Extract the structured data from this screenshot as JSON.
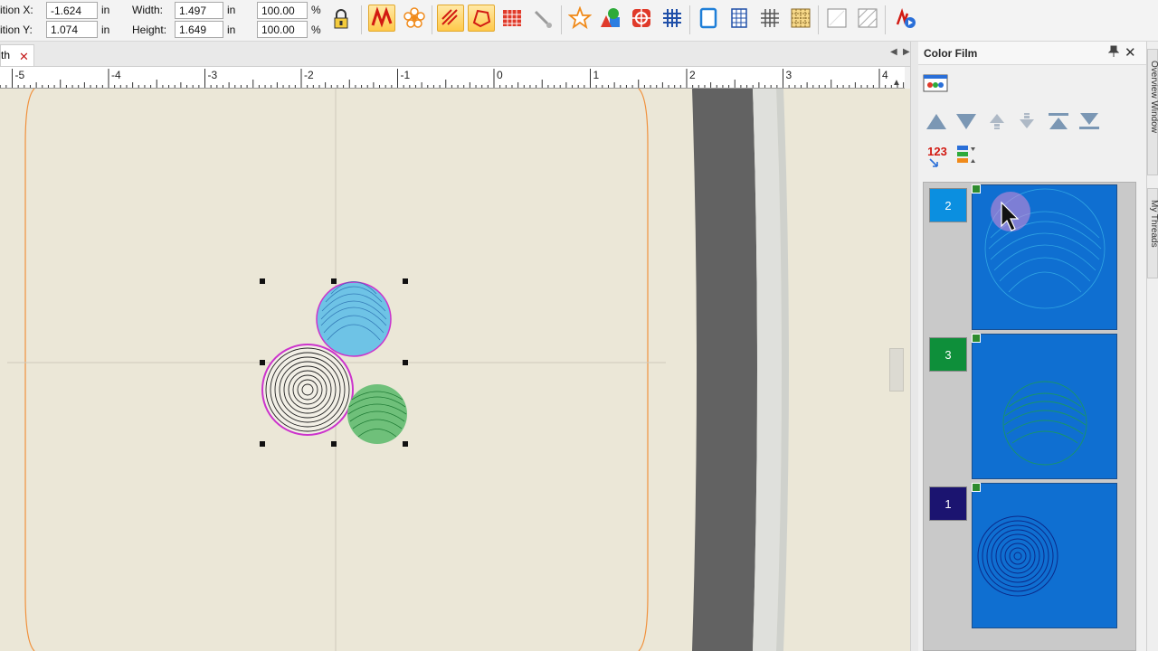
{
  "toolbar": {
    "position_x_label": "ition X:",
    "position_x_value": "-1.624",
    "position_x_unit": "in",
    "position_y_label": "ition Y:",
    "position_y_value": "1.074",
    "position_y_unit": "in",
    "width_label": "Width:",
    "width_value": "1.497",
    "width_unit": "in",
    "height_label": "Height:",
    "height_value": "1.649",
    "height_unit": "in",
    "scale_w_value": "100.00",
    "scale_w_unit": "%",
    "scale_h_value": "100.00",
    "scale_h_unit": "%",
    "tools": [
      "lock-proportions",
      "running-stitch",
      "flower-shape",
      "fill-stitch",
      "shape-outline",
      "grid-fill",
      "connector-tool",
      "star-shape",
      "shapes",
      "quilt-block",
      "crosshatch",
      "frame",
      "grid-small",
      "hash-grid",
      "pattern-fill",
      "blank-texture",
      "diagonal-texture",
      "stitch-player"
    ]
  },
  "document_tab": {
    "label": "th",
    "close": "✕"
  },
  "ruler": {
    "labels": [
      "-5",
      "-4",
      "-3",
      "-2",
      "-1",
      "0",
      "1",
      "2",
      "3",
      "4"
    ]
  },
  "panel": {
    "title": "Color Film",
    "pin_icon": "pin-icon",
    "close": "✕",
    "order_label": "123",
    "items": [
      {
        "number": "2",
        "color": "#0b8fe0"
      },
      {
        "number": "3",
        "color": "#0e8f3a"
      },
      {
        "number": "1",
        "color": "#1b1470"
      }
    ]
  },
  "side_tabs": [
    "Overview Window",
    "My Threads"
  ],
  "colors": {
    "canvas": "#ebe7d7",
    "hoop_outline": "#f0913c",
    "thumb_background": "#0f6fd1",
    "selection_outline": "#d22fd3"
  }
}
